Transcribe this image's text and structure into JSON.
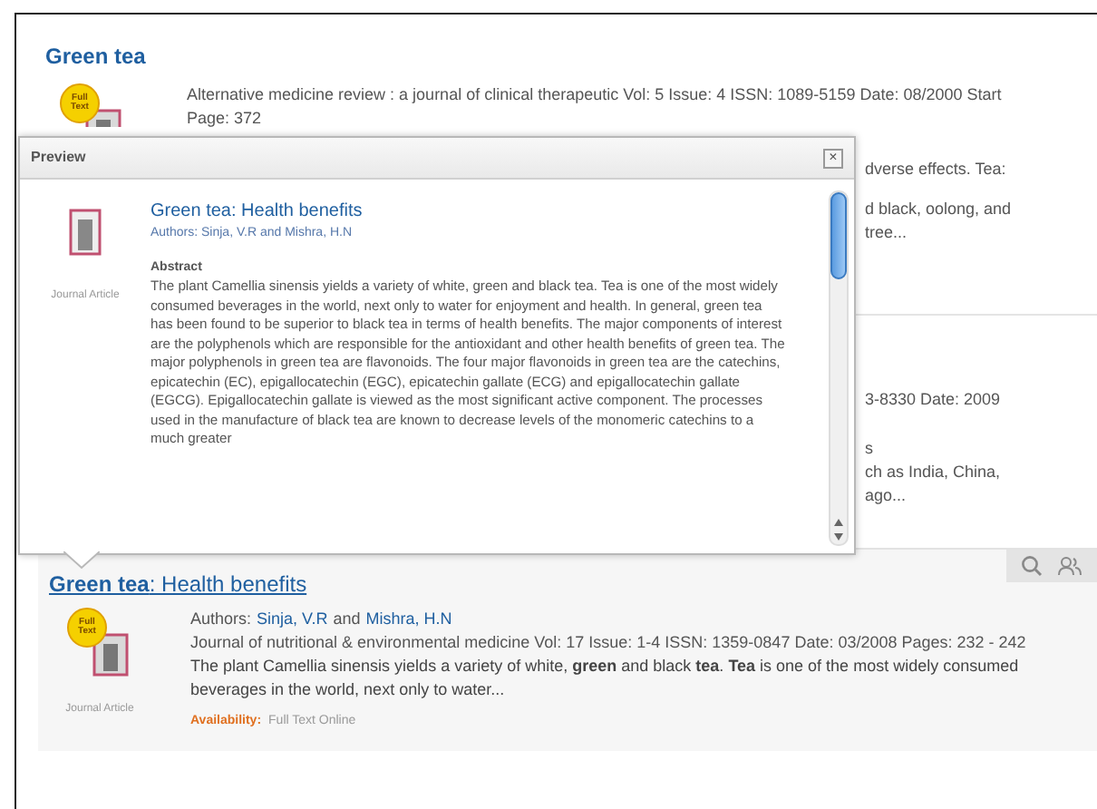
{
  "results": [
    {
      "kind": "partial",
      "title": "Green tea",
      "badge": "Full Text",
      "citation": "Alternative medicine review : a journal of clinical therapeutic Vol: 5 Issue: 4 ISSN: 1089-5159 Date: 08/2000 Start Page: 372",
      "visible_fragments": [
        "dverse effects. Tea:",
        "d black, oolong, and",
        "tree..."
      ]
    },
    {
      "kind": "hidden",
      "visible_fragments": [
        "3-8330 Date: 2009",
        "s",
        "ch as India, China,",
        "ago..."
      ]
    },
    {
      "kind": "full",
      "hovered": true,
      "title": "**Green tea**: Health benefits",
      "badge": "Full Text",
      "type": "Journal Article",
      "authors_label": "Authors:",
      "authors": [
        "Sinja, V.R",
        "Mishra, H.N"
      ],
      "authors_joiner": "and",
      "citation": "Journal of nutritional & environmental medicine Vol: 17 Issue: 1-4 ISSN: 1359-0847 Date: 03/2008 Pages: 232 - 242",
      "snippet": "The plant Camellia sinensis yields a variety of white, **green** and black **tea**. **Tea** is one of the most widely consumed beverages in the world, next only to water...",
      "availability_label": "Availability:",
      "availability": "Full Text Online"
    }
  ],
  "preview": {
    "title": "Preview",
    "close": "×",
    "item_title": "Green tea: Health benefits",
    "authors": "Authors: Sinja, V.R and Mishra, H.N",
    "type": "Journal Article",
    "abstract_heading": "Abstract",
    "abstract": "The plant Camellia sinensis yields a variety of white, green and black tea. Tea is one of the most widely consumed beverages in the world, next only to water for enjoyment and health. In general, green tea has been found to be superior to black tea in terms of health benefits. The major components of interest are the polyphenols which are responsible for the antioxidant and other health benefits of green tea. The major polyphenols in green tea are flavonoids. The four major flavonoids in green tea are the catechins, epicatechin (EC), epigallocatechin (EGC), epicatechin gallate (ECG) and epigallocatechin gallate (EGCG). Epigallocatechin gallate is viewed as the most significant active component. The processes used in the manufacture of black tea are known to decrease levels of the monomeric catechins to a much greater"
  }
}
